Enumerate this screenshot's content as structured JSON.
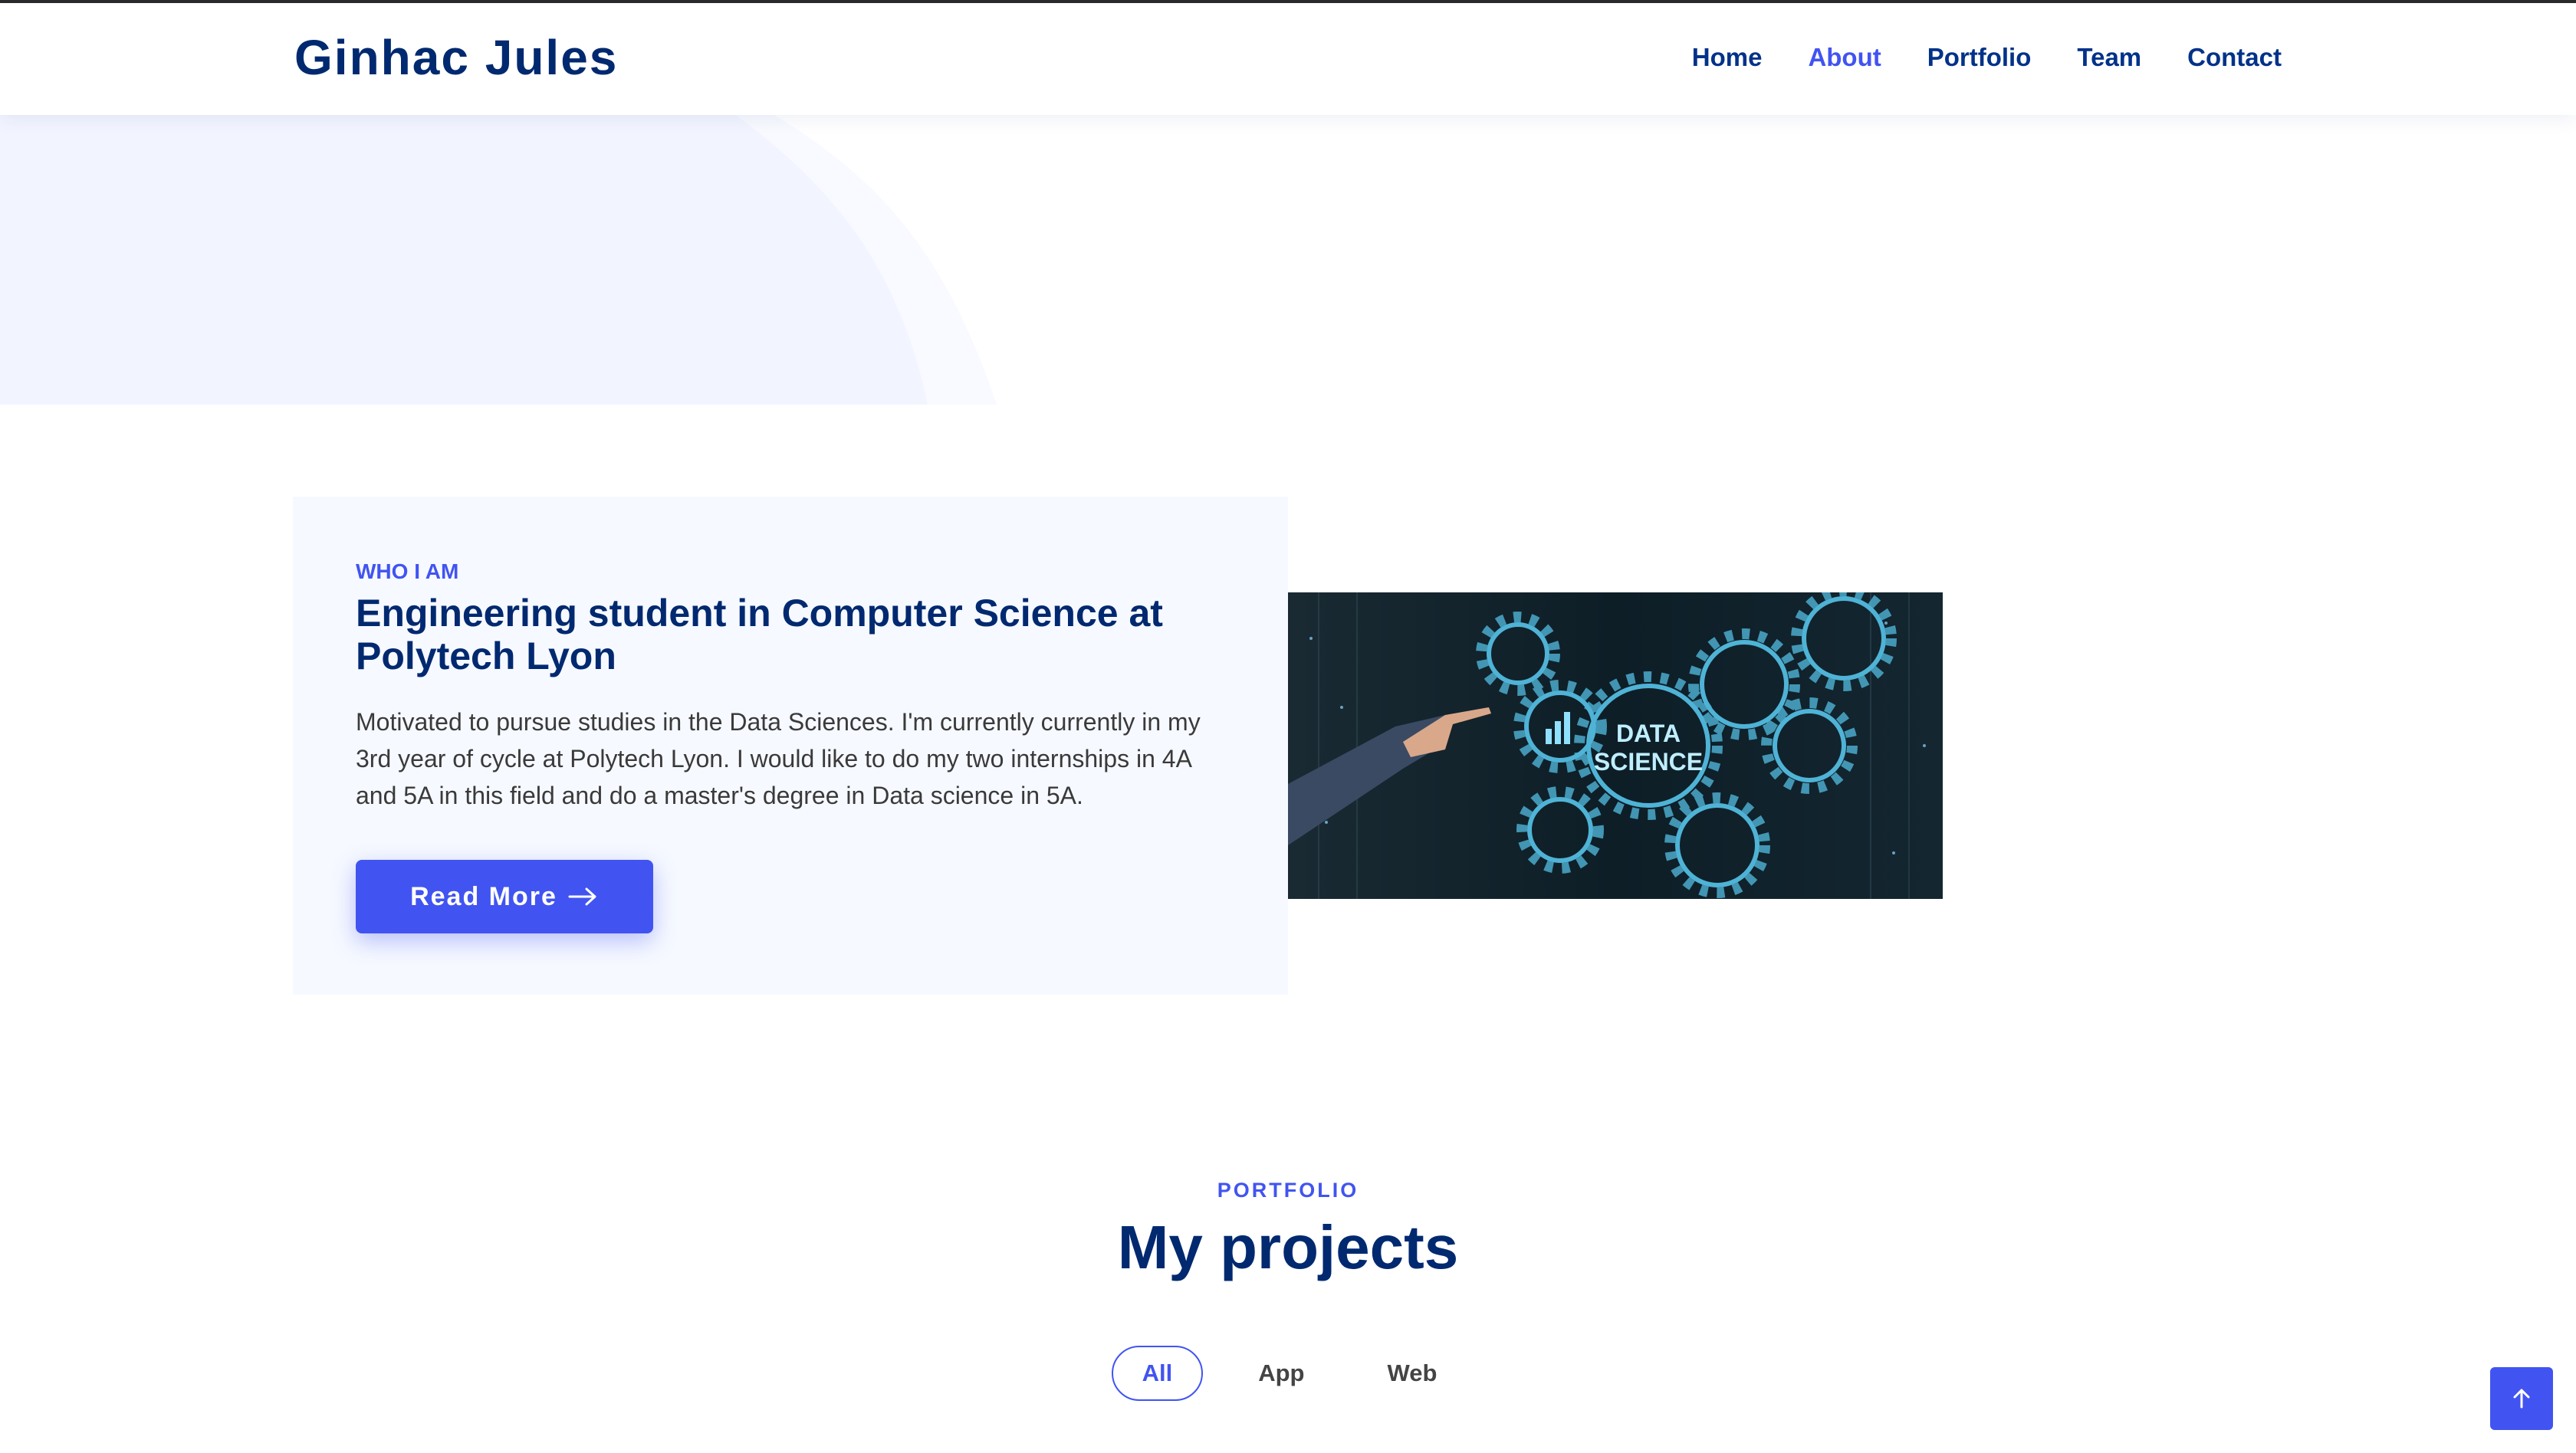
{
  "header": {
    "logo": "Ginhac Jules",
    "nav": [
      "Home",
      "About",
      "Portfolio",
      "Team",
      "Contact"
    ],
    "active_nav": "About"
  },
  "about": {
    "eyebrow": "WHO I AM",
    "title": "Engineering student in Computer Science at Polytech Lyon",
    "text": "Motivated to pursue studies in the Data Sciences. I'm currently currently in my 3rd year of cycle at Polytech Lyon. I would like to do my two internships in 4A and 5A in this field and do a master's degree in Data science in 5A.",
    "button": "Read More",
    "image_label_1": "DATA",
    "image_label_2": "SCIENCE"
  },
  "portfolio": {
    "eyebrow": "PORTFOLIO",
    "title": "My projects",
    "filters": [
      "All",
      "App",
      "Web"
    ],
    "active_filter": "All"
  },
  "colors": {
    "primary": "#4154f1",
    "heading": "#012970",
    "card_bg": "#f6f9ff"
  },
  "icons": {
    "read_more": "arrow-right-icon",
    "back_to_top": "arrow-up-icon"
  }
}
